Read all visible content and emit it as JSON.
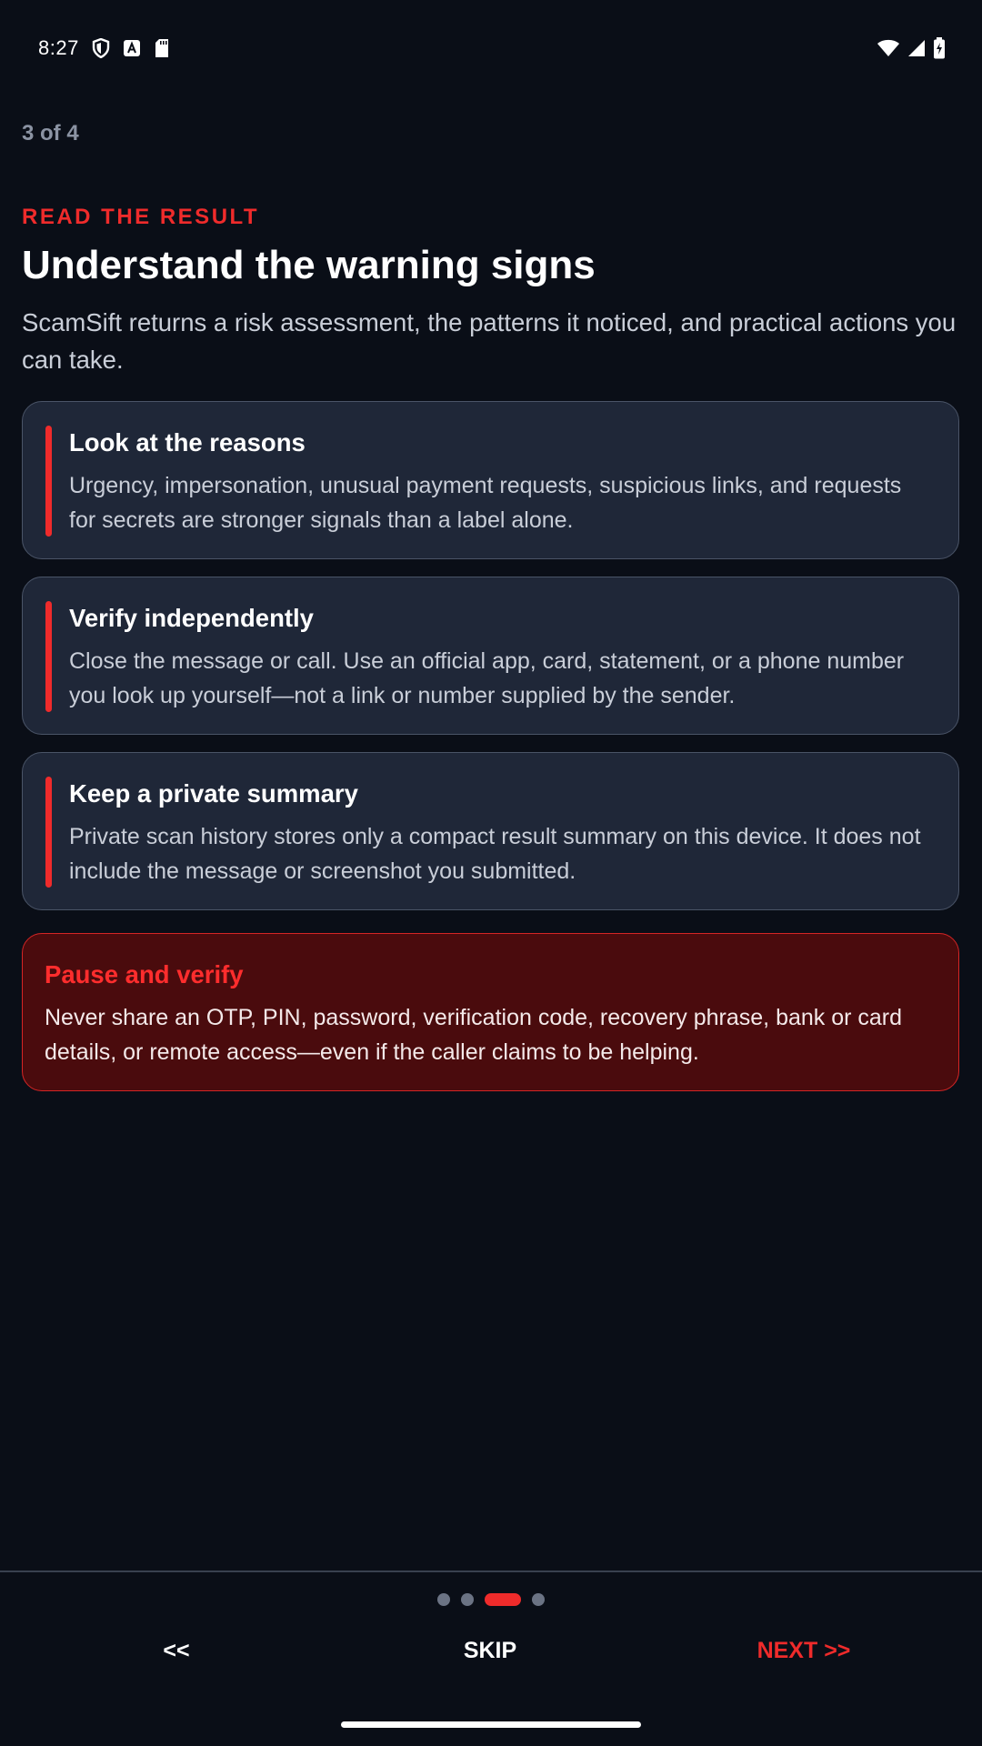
{
  "status_bar": {
    "time": "8:27",
    "icons": [
      "shield-icon",
      "a-badge-icon",
      "sd-card-icon",
      "wifi-icon",
      "signal-icon",
      "battery-charging-icon"
    ]
  },
  "onboarding": {
    "step_counter": "3 of 4",
    "eyebrow": "READ THE RESULT",
    "title": "Understand the warning signs",
    "subtitle": "ScamSift returns a risk assessment, the patterns it noticed, and practical actions you can take.",
    "cards": [
      {
        "title": "Look at the reasons",
        "body": "Urgency, impersonation, unusual payment requests, suspicious links, and requests for secrets are stronger signals than a label alone."
      },
      {
        "title": "Verify independently",
        "body": "Close the message or call. Use an official app, card, statement, or a phone number you look up yourself—not a link or number supplied by the sender."
      },
      {
        "title": "Keep a private summary",
        "body": "Private scan history stores only a compact result summary on this device. It does not include the message or screenshot you submitted."
      }
    ],
    "warning": {
      "title": "Pause and verify",
      "body": "Never share an OTP, PIN, password, verification code, recovery phrase, bank or card details, or remote access—even if the caller claims to be helping."
    }
  },
  "navigation": {
    "page_indicator": {
      "total": 4,
      "current": 3
    },
    "back_label": "<<",
    "skip_label": "SKIP",
    "next_label": "NEXT >>"
  },
  "colors": {
    "background": "#0a0e17",
    "accent": "#ef2b2b",
    "card": "#1f2738",
    "warning_bg": "#4a0b0d"
  }
}
